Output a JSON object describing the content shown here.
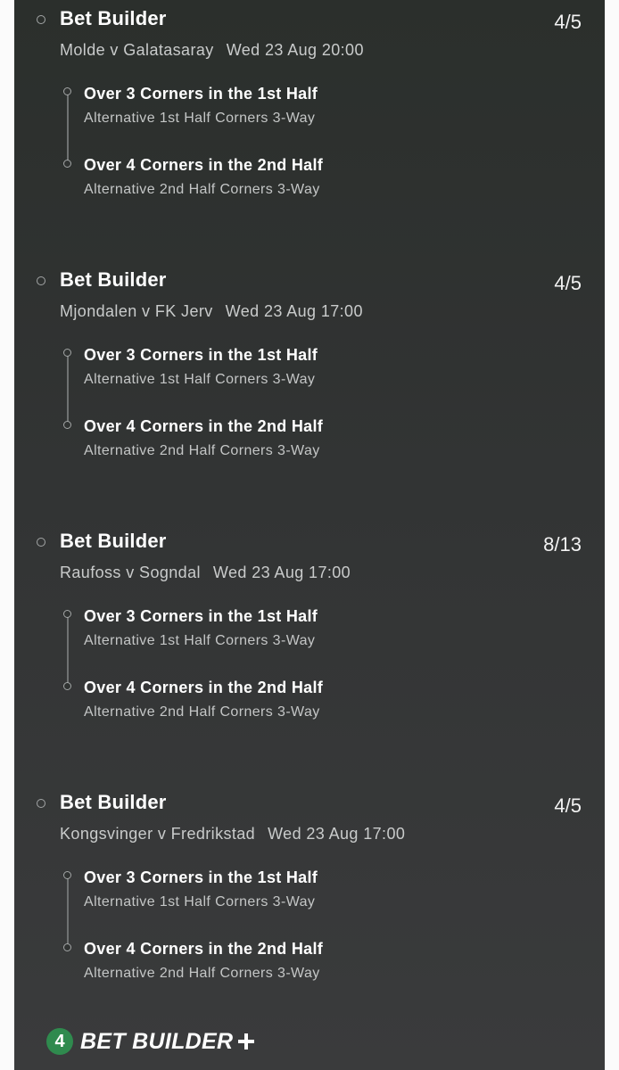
{
  "bets": [
    {
      "title": "Bet Builder",
      "odds": "4/5",
      "match": "Molde v Galatasaray",
      "datetime": "Wed 23 Aug 20:00",
      "legs": [
        {
          "name": "Over 3 Corners in the 1st Half",
          "market": "Alternative 1st Half Corners 3-Way"
        },
        {
          "name": "Over 4 Corners in the 2nd Half",
          "market": "Alternative 2nd Half Corners 3-Way"
        }
      ]
    },
    {
      "title": "Bet Builder",
      "odds": "4/5",
      "match": "Mjondalen v FK Jerv",
      "datetime": "Wed 23 Aug 17:00",
      "legs": [
        {
          "name": "Over 3 Corners in the 1st Half",
          "market": "Alternative 1st Half Corners 3-Way"
        },
        {
          "name": "Over 4 Corners in the 2nd Half",
          "market": "Alternative 2nd Half Corners 3-Way"
        }
      ]
    },
    {
      "title": "Bet Builder",
      "odds": "8/13",
      "match": "Raufoss v Sogndal",
      "datetime": "Wed 23 Aug 17:00",
      "legs": [
        {
          "name": "Over 3 Corners in the 1st Half",
          "market": "Alternative 1st Half Corners 3-Way"
        },
        {
          "name": "Over 4 Corners in the 2nd Half",
          "market": "Alternative 2nd Half Corners 3-Way"
        }
      ]
    },
    {
      "title": "Bet Builder",
      "odds": "4/5",
      "match": "Kongsvinger v Fredrikstad",
      "datetime": "Wed 23 Aug 17:00",
      "legs": [
        {
          "name": "Over 3 Corners in the 1st Half",
          "market": "Alternative 1st Half Corners 3-Way"
        },
        {
          "name": "Over 4 Corners in the 2nd Half",
          "market": "Alternative 2nd Half Corners 3-Way"
        }
      ]
    }
  ],
  "footer": {
    "badge_number": "4",
    "brand_text": "BET BUILDER",
    "brand_icon": "plus-icon",
    "brand_color": "#2f8a4e"
  },
  "colors": {
    "panel_background": "#2f3231",
    "text_primary": "#ffffff",
    "text_secondary": "#c4c6c6"
  }
}
